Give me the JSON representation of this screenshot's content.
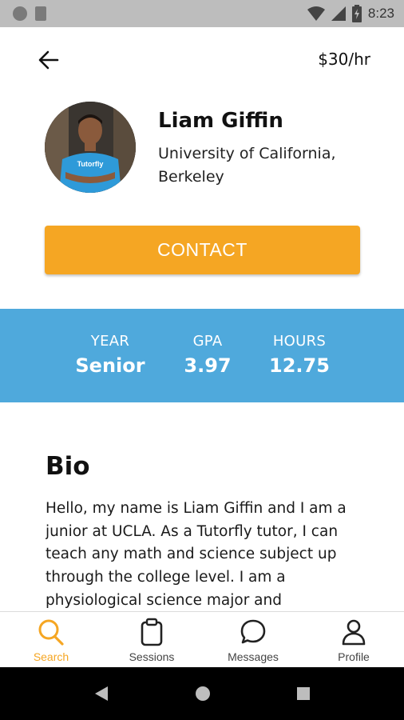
{
  "status_bar": {
    "time": "8:23"
  },
  "header": {
    "rate": "$30/hr"
  },
  "profile": {
    "name": "Liam Giffin",
    "school": "University of California, Berkeley",
    "avatar_shirt_text": "Tutorfly"
  },
  "contact_button": {
    "label": "CONTACT"
  },
  "stats": [
    {
      "label": "YEAR",
      "value": "Senior"
    },
    {
      "label": "GPA",
      "value": "3.97"
    },
    {
      "label": "HOURS",
      "value": "12.75"
    }
  ],
  "bio": {
    "title": "Bio",
    "text": "Hello, my name is Liam Giffin and I am a junior at UCLA. As a Tutorfly tutor, I can teach any math and science subject up through the college level. I am a physiological science major and"
  },
  "bottom_nav": {
    "items": [
      {
        "label": "Search",
        "icon": "search-icon",
        "active": true
      },
      {
        "label": "Sessions",
        "icon": "clipboard-icon",
        "active": false
      },
      {
        "label": "Messages",
        "icon": "chat-bubble-icon",
        "active": false
      },
      {
        "label": "Profile",
        "icon": "person-icon",
        "active": false
      }
    ]
  },
  "colors": {
    "accent": "#f5a623",
    "stats_band": "#4fa9dc",
    "status_bar": "#bdbdbd",
    "nav_bar": "#000000"
  }
}
